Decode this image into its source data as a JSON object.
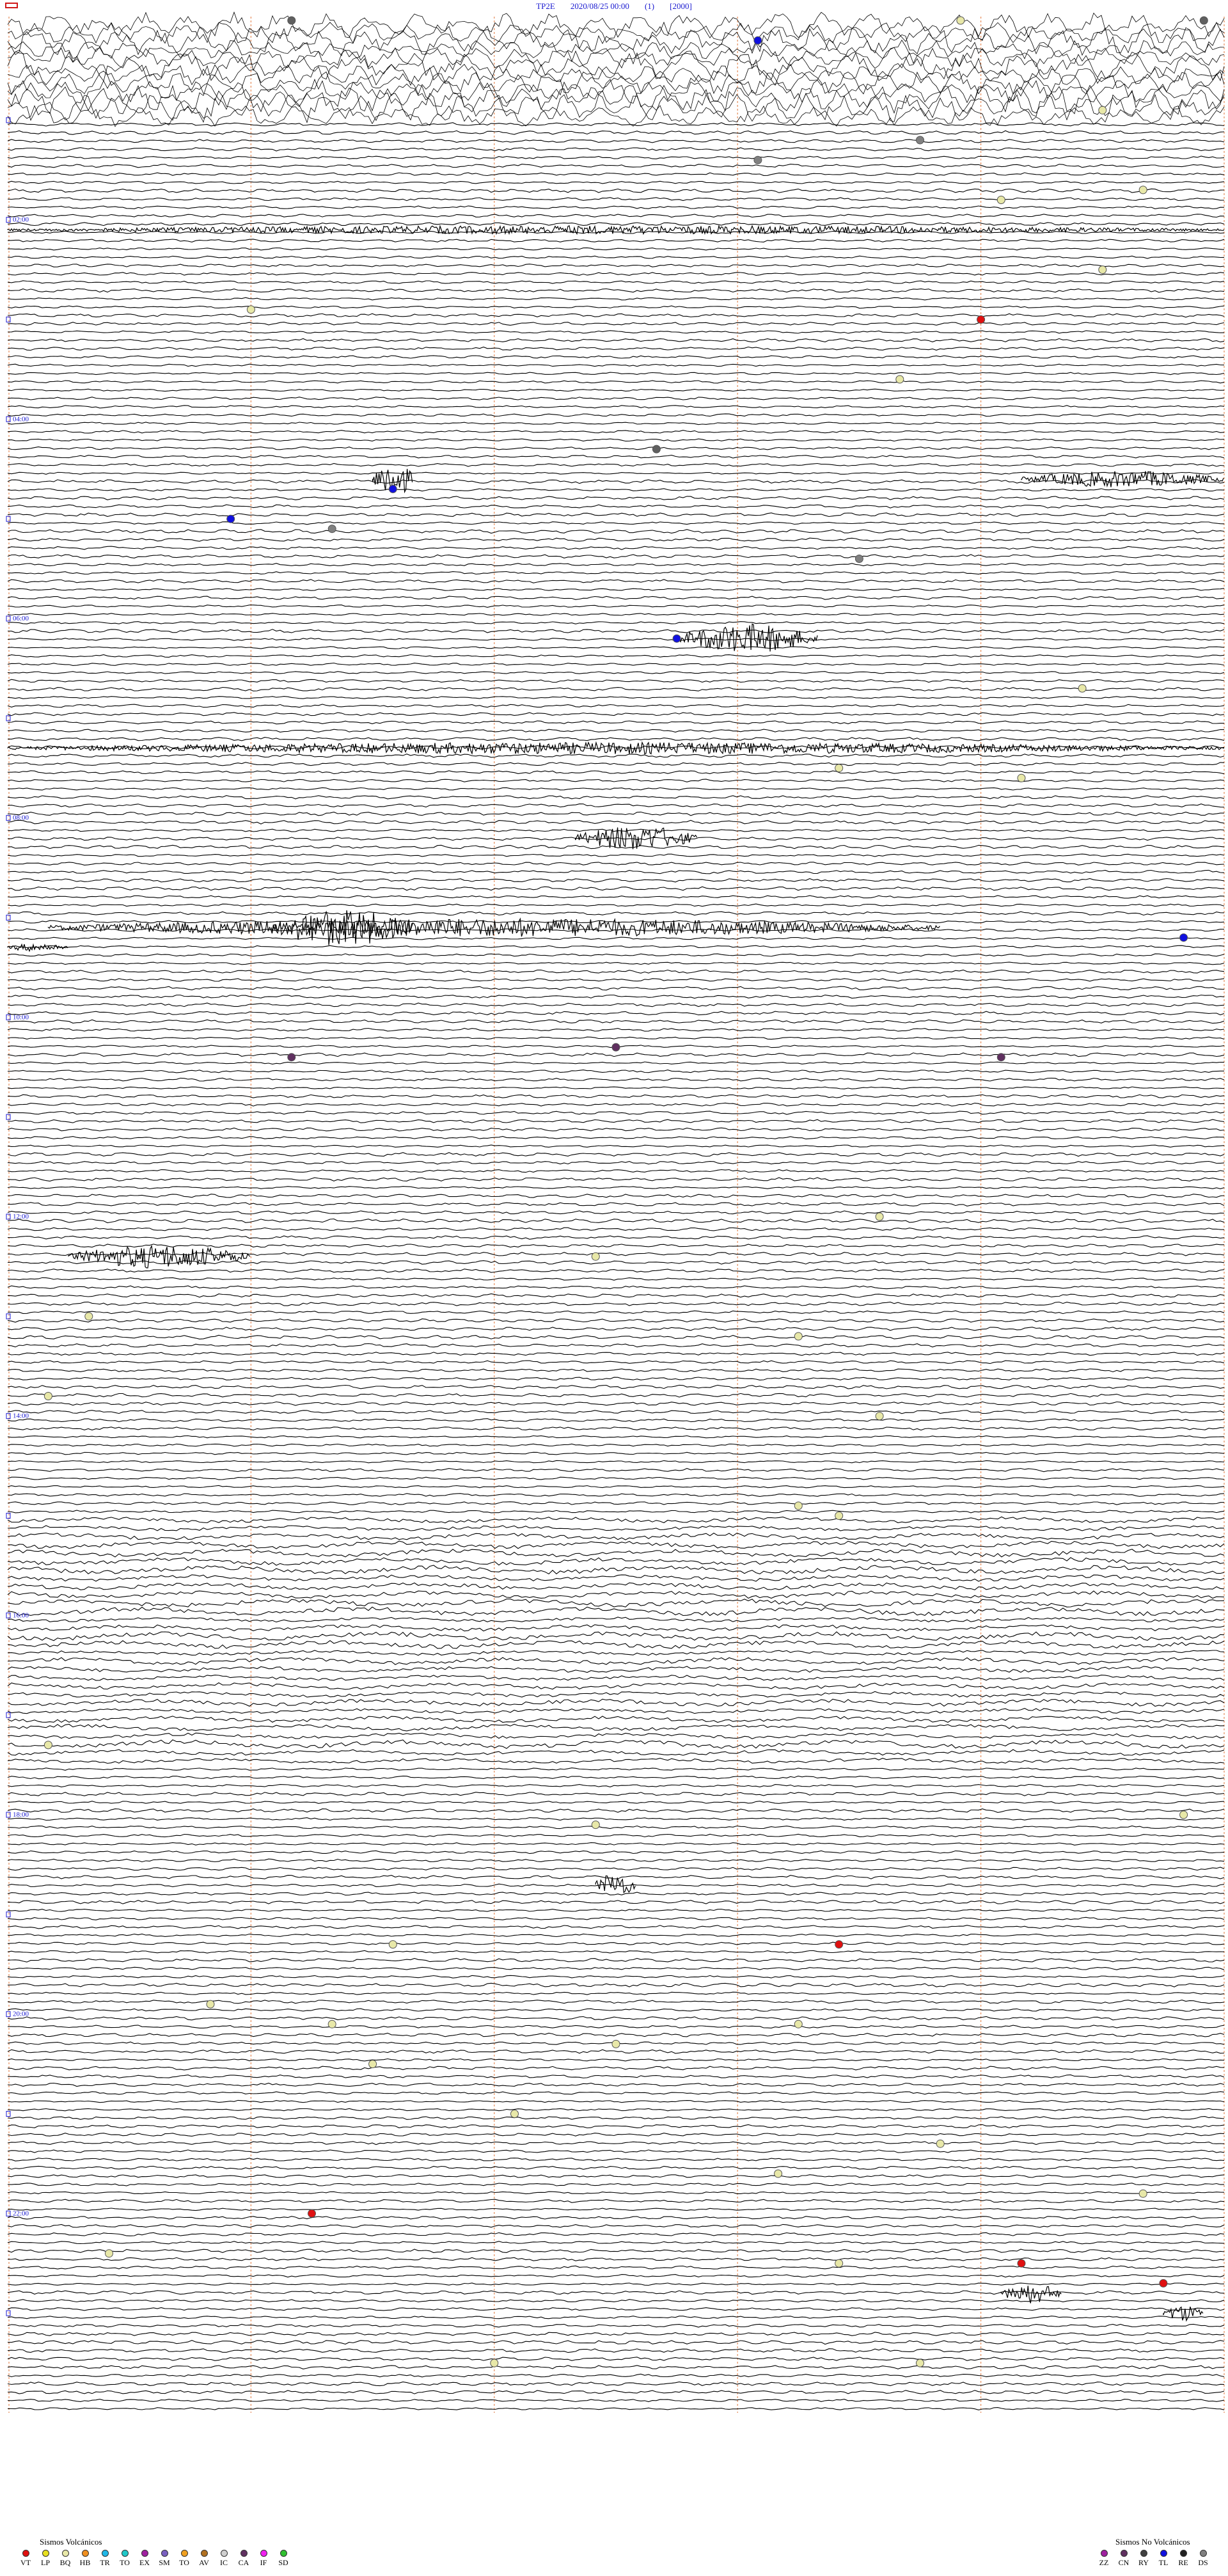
{
  "header": {
    "station": "TP2E",
    "datetime": "2020/08/25 00:00",
    "channel": "(1)",
    "gain": "[2000]"
  },
  "hour_labels": [
    "02:00",
    "04:00",
    "06:00",
    "08:00",
    "10:00",
    "12:00",
    "14:00",
    "16:00",
    "18:00",
    "20:00",
    "22:00"
  ],
  "legend_volcanic": {
    "title": "Sismos Volcánicos",
    "items": [
      {
        "code": "VT",
        "color": "#e01010"
      },
      {
        "code": "LP",
        "color": "#e8e020"
      },
      {
        "code": "BQ",
        "color": "#e8e8a8"
      },
      {
        "code": "HB",
        "color": "#f09020"
      },
      {
        "code": "TR",
        "color": "#20b8e8"
      },
      {
        "code": "TO",
        "color": "#20c8c8"
      },
      {
        "code": "EX",
        "color": "#a020a0"
      },
      {
        "code": "SM",
        "color": "#7a60c0"
      },
      {
        "code": "TO",
        "color": "#f0a020"
      },
      {
        "code": "AV",
        "color": "#b07020"
      },
      {
        "code": "IC",
        "color": "#d0d0d0"
      },
      {
        "code": "CA",
        "color": "#603060"
      },
      {
        "code": "IF",
        "color": "#f020f0"
      },
      {
        "code": "SD",
        "color": "#30c030"
      }
    ]
  },
  "legend_nonvolcanic": {
    "title": "Sismos No Volcánicos",
    "items": [
      {
        "code": "ZZ",
        "color": "#a020a0"
      },
      {
        "code": "CN",
        "color": "#603060"
      },
      {
        "code": "RY",
        "color": "#404040"
      },
      {
        "code": "TL",
        "color": "#1010e0"
      },
      {
        "code": "RE",
        "color": "#202020"
      },
      {
        "code": "DS",
        "color": "#808080"
      }
    ]
  },
  "events": [
    {
      "hour": 0.0,
      "min": 14,
      "color": "#606060"
    },
    {
      "hour": 0.0,
      "min": 47,
      "color": "#e8e8a8"
    },
    {
      "hour": 0.0,
      "min": 59,
      "color": "#606060"
    },
    {
      "hour": 0.2,
      "min": 37,
      "color": "#1010e0"
    },
    {
      "hour": 0.9,
      "min": 54,
      "color": "#e8e8a8"
    },
    {
      "hour": 1.2,
      "min": 45,
      "color": "#808080"
    },
    {
      "hour": 1.4,
      "min": 37,
      "color": "#808080"
    },
    {
      "hour": 1.7,
      "min": 56,
      "color": "#e8e8a8"
    },
    {
      "hour": 1.8,
      "min": 49,
      "color": "#e8e8a8"
    },
    {
      "hour": 2.5,
      "min": 54,
      "color": "#e8e8a8"
    },
    {
      "hour": 2.9,
      "min": 12,
      "color": "#e8e8a8"
    },
    {
      "hour": 3.0,
      "min": 48,
      "color": "#e01010"
    },
    {
      "hour": 3.6,
      "min": 44,
      "color": "#e8e8a8"
    },
    {
      "hour": 4.3,
      "min": 32,
      "color": "#606060"
    },
    {
      "hour": 4.7,
      "min": 19,
      "color": "#1010e0"
    },
    {
      "hour": 5.0,
      "min": 11,
      "color": "#1010e0"
    },
    {
      "hour": 5.1,
      "min": 16,
      "color": "#808080"
    },
    {
      "hour": 5.4,
      "min": 42,
      "color": "#808080"
    },
    {
      "hour": 6.2,
      "min": 33,
      "color": "#1010e0"
    },
    {
      "hour": 6.7,
      "min": 53,
      "color": "#e8e8a8"
    },
    {
      "hour": 7.5,
      "min": 41,
      "color": "#e8e8a8"
    },
    {
      "hour": 7.6,
      "min": 50,
      "color": "#e8e8a8"
    },
    {
      "hour": 9.2,
      "min": 58,
      "color": "#1010e0"
    },
    {
      "hour": 10.4,
      "min": 14,
      "color": "#603060"
    },
    {
      "hour": 10.3,
      "min": 30,
      "color": "#603060"
    },
    {
      "hour": 10.4,
      "min": 49,
      "color": "#603060"
    },
    {
      "hour": 12.0,
      "min": 43,
      "color": "#e8e8a8"
    },
    {
      "hour": 12.4,
      "min": 29,
      "color": "#e8e8a8"
    },
    {
      "hour": 13.0,
      "min": 4,
      "color": "#e8e8a8"
    },
    {
      "hour": 13.2,
      "min": 39,
      "color": "#e8e8a8"
    },
    {
      "hour": 13.8,
      "min": 2,
      "color": "#e8e8a8"
    },
    {
      "hour": 14.0,
      "min": 43,
      "color": "#e8e8a8"
    },
    {
      "hour": 14.9,
      "min": 39,
      "color": "#e8e8a8"
    },
    {
      "hour": 15.0,
      "min": 41,
      "color": "#e8e8a8"
    },
    {
      "hour": 17.3,
      "min": 2,
      "color": "#e8e8a8"
    },
    {
      "hour": 18.1,
      "min": 29,
      "color": "#e8e8a8"
    },
    {
      "hour": 18.0,
      "min": 58,
      "color": "#e8e8a8"
    },
    {
      "hour": 19.3,
      "min": 41,
      "color": "#e01010"
    },
    {
      "hour": 19.3,
      "min": 19,
      "color": "#e8e8a8"
    },
    {
      "hour": 19.9,
      "min": 10,
      "color": "#e8e8a8"
    },
    {
      "hour": 20.1,
      "min": 16,
      "color": "#e8e8a8"
    },
    {
      "hour": 20.3,
      "min": 30,
      "color": "#e8e8a8"
    },
    {
      "hour": 20.1,
      "min": 39,
      "color": "#e8e8a8"
    },
    {
      "hour": 20.5,
      "min": 18,
      "color": "#e8e8a8"
    },
    {
      "hour": 21.0,
      "min": 25,
      "color": "#e8e8a8"
    },
    {
      "hour": 21.3,
      "min": 46,
      "color": "#e8e8a8"
    },
    {
      "hour": 21.6,
      "min": 38,
      "color": "#e8e8a8"
    },
    {
      "hour": 21.8,
      "min": 56,
      "color": "#e8e8a8"
    },
    {
      "hour": 22.0,
      "min": 15,
      "color": "#e01010"
    },
    {
      "hour": 22.4,
      "min": 5,
      "color": "#e8e8a8"
    },
    {
      "hour": 22.5,
      "min": 41,
      "color": "#e8e8a8"
    },
    {
      "hour": 22.5,
      "min": 50,
      "color": "#e01010"
    },
    {
      "hour": 22.7,
      "min": 57,
      "color": "#e01010"
    },
    {
      "hour": 23.5,
      "min": 24,
      "color": "#e8e8a8"
    },
    {
      "hour": 23.5,
      "min": 45,
      "color": "#e8e8a8"
    }
  ]
}
